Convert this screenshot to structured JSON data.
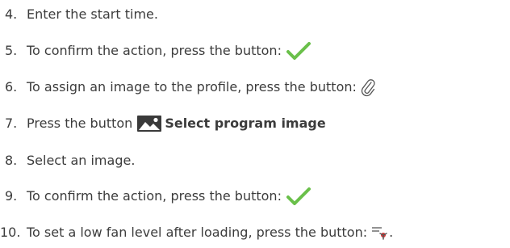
{
  "steps": [
    {
      "number": "4.",
      "text": "Enter the start time."
    },
    {
      "number": "5.",
      "text": "To confirm the action, press the button:",
      "icon": "check-icon"
    },
    {
      "number": "6.",
      "text": "To assign an image to the profile, press the button:",
      "icon": "paperclip-icon"
    },
    {
      "number": "7.",
      "text": "Press the button",
      "icon": "image-icon",
      "bold_text": "Select program image"
    },
    {
      "number": "8.",
      "text": "Select an image."
    },
    {
      "number": "9.",
      "text": "To confirm the action, press the button:",
      "icon": "check-icon"
    },
    {
      "number": "10.",
      "text": "To set a low fan level after loading, press the button:",
      "icon": "fan-low-icon",
      "suffix": "."
    }
  ],
  "colors": {
    "text": "#3c3c3c",
    "check": "#6ac04a",
    "icon_dark": "#3a3a3a"
  }
}
